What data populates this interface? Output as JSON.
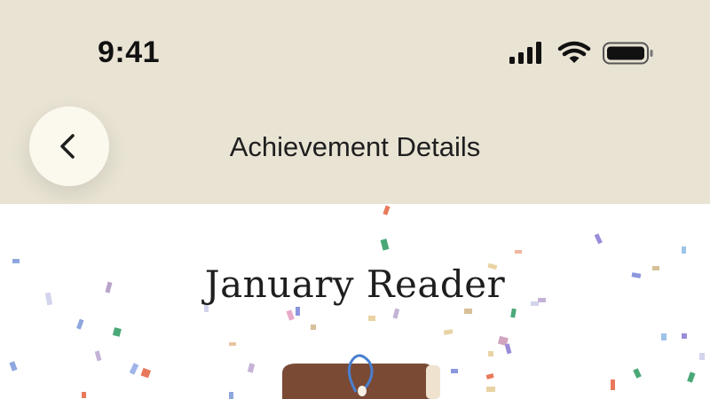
{
  "status_bar": {
    "time": "9:41",
    "icons": [
      "signal-icon",
      "wifi-icon",
      "battery-icon"
    ]
  },
  "nav": {
    "back_icon": "chevron-left-icon",
    "title": "Achievement Details"
  },
  "achievement": {
    "title": "January Reader"
  },
  "colors": {
    "header_bg": "#e8e3d3",
    "back_button_bg": "#fbf8ee",
    "content_bg": "#ffffff",
    "text": "#1e1e1e",
    "book_brown": "#7a4a35",
    "accent_blue": "#4a7fd0"
  }
}
